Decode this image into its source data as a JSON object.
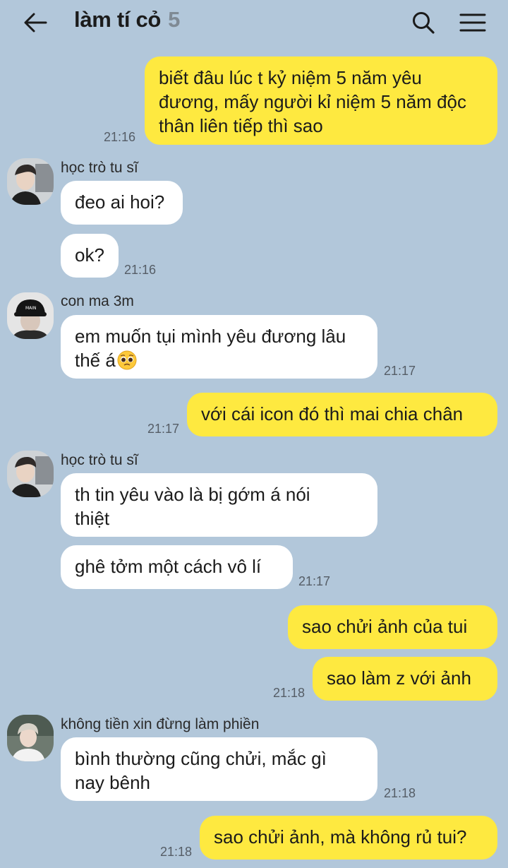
{
  "header": {
    "title": "làm tí cỏ",
    "member_count": "5",
    "back_icon": "arrow-left-icon",
    "search_icon": "search-icon",
    "menu_icon": "hamburger-menu-icon"
  },
  "colors": {
    "background": "#b2c7da",
    "my_bubble": "#fee940",
    "their_bubble": "#ffffff"
  },
  "messages": [
    {
      "from": "me",
      "lines": [
        "biết đâu lúc t kỷ niệm 5 năm yêu",
        "đương, mấy người kỉ niệm 5 năm độc",
        "thân liên tiếp thì sao"
      ],
      "time": "21:16"
    },
    {
      "from": "học trò tu sĩ",
      "lines": [
        "đeo ai hoi?"
      ]
    },
    {
      "from": "học trò tu sĩ",
      "lines": [
        "ok?"
      ],
      "time": "21:16"
    },
    {
      "from": "con ma 3m",
      "lines": [
        "em muốn tụi mình yêu đương lâu",
        "thế á"
      ],
      "emoji": "pleading-face-emoji",
      "time": "21:17"
    },
    {
      "from": "me",
      "lines": [
        "với cái icon đó thì mai chia chân"
      ],
      "time": "21:17"
    },
    {
      "from": "học trò tu sĩ",
      "lines": [
        "th tin yêu vào là bị gớm á nói",
        "thiệt"
      ]
    },
    {
      "from": "học trò tu sĩ",
      "lines": [
        "ghê tởm một cách vô lí"
      ],
      "time": "21:17"
    },
    {
      "from": "me",
      "lines": [
        "sao chửi ảnh của tui"
      ]
    },
    {
      "from": "me",
      "lines": [
        "sao làm z với ảnh"
      ],
      "time": "21:18"
    },
    {
      "from": "không tiền xin đừng làm phiền",
      "lines": [
        "bình thường cũng chửi, mắc gì",
        "nay bênh"
      ],
      "time": "21:18"
    },
    {
      "from": "me",
      "lines": [
        "sao chửi ảnh, mà không rủ tui?"
      ],
      "time": "21:18"
    }
  ]
}
